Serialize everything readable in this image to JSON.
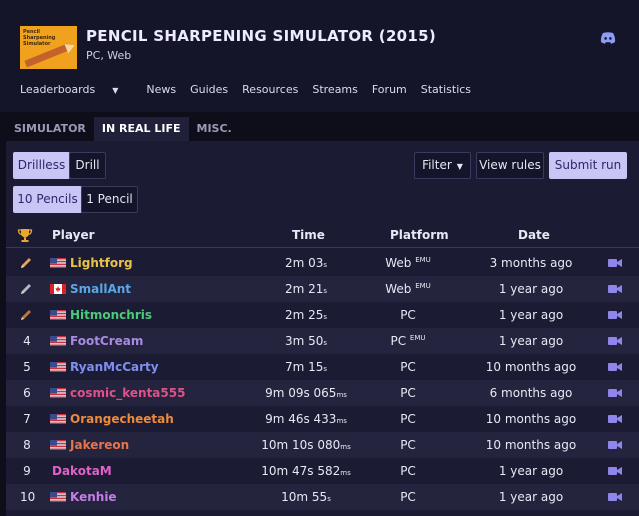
{
  "game": {
    "title": "PENCIL SHARPENING SIMULATOR (2015)",
    "platforms": "PC, Web",
    "logo_text": "Pencil Sharpening Simulator"
  },
  "nav": [
    "Leaderboards",
    "News",
    "Guides",
    "Resources",
    "Streams",
    "Forum",
    "Statistics"
  ],
  "tabs": [
    "SIMULATOR",
    "IN REAL LIFE",
    "MISC."
  ],
  "active_tab": "IN REAL LIFE",
  "filters": {
    "drillless": "Drillless",
    "drill": "Drill",
    "ten_pencils": "10 Pencils",
    "one_pencil": "1 Pencil",
    "filter": "Filter",
    "view_rules": "View rules",
    "submit_run": "Submit run"
  },
  "columns": {
    "player": "Player",
    "time": "Time",
    "platform": "Platform",
    "date": "Date"
  },
  "rows": [
    {
      "rank": "",
      "medal": "gold-pencil-icon",
      "flag": "us",
      "player": "Lightforg",
      "color": "#e8c34a",
      "time_main": "2m 03",
      "time_unit": "s",
      "platform": "Web",
      "emu": "EMU",
      "date": "3 months ago"
    },
    {
      "rank": "",
      "medal": "silver-pencil-icon",
      "flag": "ca",
      "player": "SmallAnt",
      "color": "#5aa7e8",
      "time_main": "2m 21",
      "time_unit": "s",
      "platform": "Web",
      "emu": "EMU",
      "date": "1 year ago"
    },
    {
      "rank": "",
      "medal": "bronze-pencil-icon",
      "flag": "us",
      "player": "Hitmonchris",
      "color": "#4cc97a",
      "time_main": "2m 25",
      "time_unit": "s",
      "platform": "PC",
      "emu": "",
      "date": "1 year ago"
    },
    {
      "rank": "4",
      "medal": "",
      "flag": "us",
      "player": "FootCream",
      "color": "#a78be0",
      "time_main": "3m 50",
      "time_unit": "s",
      "platform": "PC",
      "emu": "EMU",
      "date": "1 year ago"
    },
    {
      "rank": "5",
      "medal": "",
      "flag": "us",
      "player": "RyanMcCarty",
      "color": "#7f8ff0",
      "time_main": "7m 15",
      "time_unit": "s",
      "platform": "PC",
      "emu": "",
      "date": "10 months ago"
    },
    {
      "rank": "6",
      "medal": "",
      "flag": "us",
      "player": "cosmic_kenta555",
      "color": "#e0508a",
      "time_main": "9m 09s 065",
      "time_unit": "ms",
      "platform": "PC",
      "emu": "",
      "date": "6 months ago"
    },
    {
      "rank": "7",
      "medal": "",
      "flag": "us",
      "player": "Orangecheetah",
      "color": "#ee8a3a",
      "time_main": "9m 46s 433",
      "time_unit": "ms",
      "platform": "PC",
      "emu": "",
      "date": "10 months ago"
    },
    {
      "rank": "8",
      "medal": "",
      "flag": "us",
      "player": "Jakereon",
      "color": "#e8744a",
      "time_main": "10m 10s 080",
      "time_unit": "ms",
      "platform": "PC",
      "emu": "",
      "date": "10 months ago"
    },
    {
      "rank": "9",
      "medal": "",
      "flag": "",
      "player": "DakotaM",
      "color": "#e062c8",
      "time_main": "10m 47s 582",
      "time_unit": "ms",
      "platform": "PC",
      "emu": "",
      "date": "1 year ago"
    },
    {
      "rank": "10",
      "medal": "",
      "flag": "us",
      "player": "Kenhie",
      "color": "#c47fe6",
      "time_main": "10m 55",
      "time_unit": "s",
      "platform": "PC",
      "emu": "",
      "date": "1 year ago"
    }
  ],
  "colors": {
    "accent": "#c9c5f5",
    "video": "#8f86ec",
    "bg": "#0e0e1a",
    "panel": "#1b1b33"
  }
}
